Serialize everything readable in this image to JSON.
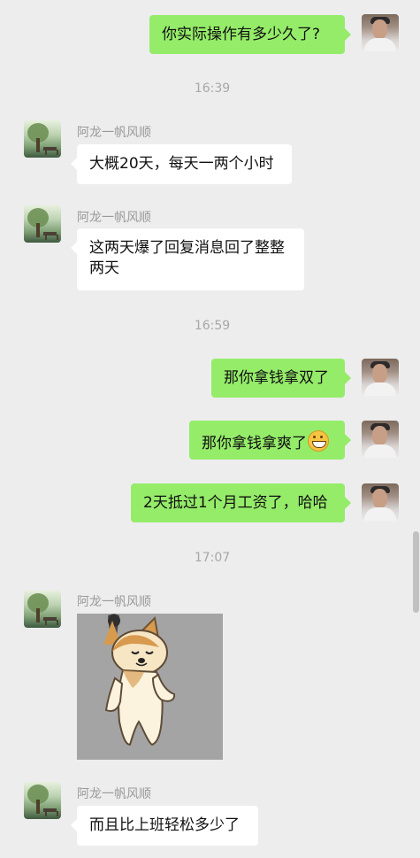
{
  "self": {
    "avatar_icon": "user-avatar-icon"
  },
  "contact": {
    "name": "阿龙一帆风顺",
    "avatar_icon": "contact-avatar-icon"
  },
  "messages": [
    {
      "text": "你实际操作有多少久了?"
    },
    {
      "time": "16:39"
    },
    {
      "text": "大概20天，每天一两个小时"
    },
    {
      "text_line1": "这两天爆了回复消息回了整整",
      "text_line2": "两天"
    },
    {
      "time": "16:59"
    },
    {
      "text": "那你拿钱拿双了"
    },
    {
      "text": "那你拿钱拿爽了",
      "emoji": "grinning-face-icon"
    },
    {
      "text": "2天抵过1个月工资了，哈哈"
    },
    {
      "time": "17:07"
    },
    {
      "sticker": "shiba-dog-sticker"
    },
    {
      "text": "而且比上班轻松多少了"
    }
  ],
  "colors": {
    "background": "#ededed",
    "self_bubble": "#95ec69",
    "other_bubble": "#ffffff",
    "name_text": "#9a9a9a",
    "time_text": "#a8a8a8"
  }
}
